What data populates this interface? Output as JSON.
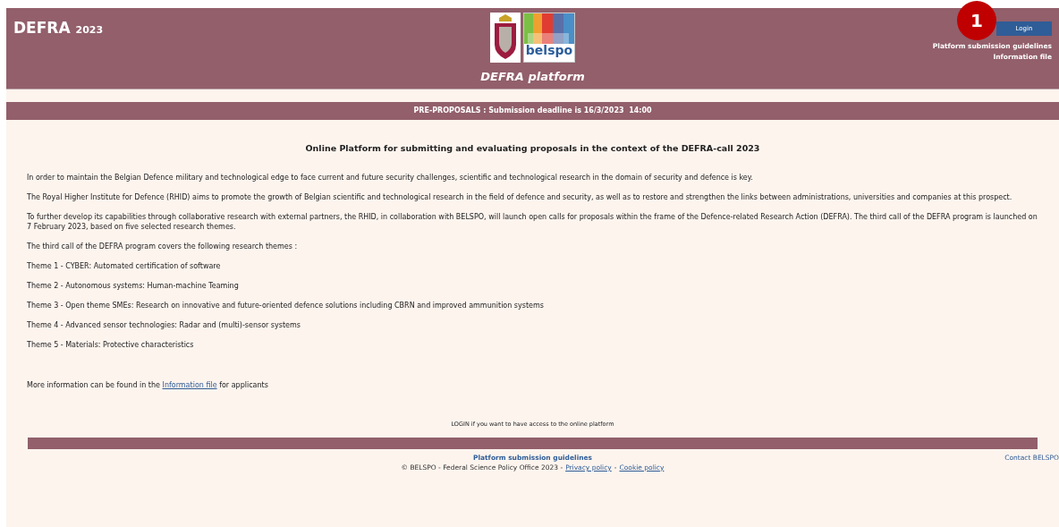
{
  "header": {
    "brand": "DEFRA",
    "year": "2023",
    "logo_text": "belspo",
    "platform_title": "DEFRA platform",
    "login_button": "Login",
    "callout_number": "1",
    "links": [
      "Platform submission guidelines",
      "Information file"
    ]
  },
  "deadline_bar": "PRE-PROPOSALS : Submission deadline is 16/3/2023  14:00",
  "content": {
    "heading": "Online Platform for submitting and evaluating proposals in the context of the DEFRA-call 2023",
    "paragraphs": [
      "In order to maintain the Belgian Defence military and technological edge to face current and future security challenges, scientific and technological research in the domain of security and defence is key.",
      "The Royal Higher Institute for Defence (RHID) aims to promote the growth of Belgian scientific and technological research in the field of defence and security, as well as to restore and strengthen the links between administrations, universities and companies at this prospect.",
      "To further develop its capabilities through collaborative research with external partners, the RHID, in collaboration with BELSPO, will launch open calls for proposals within the frame of the Defence-related Research Action (DEFRA). The third call of the DEFRA program is launched on 7 February 2023, based on five selected research themes.",
      "The third call of the DEFRA program covers the following research themes :"
    ],
    "themes": [
      "Theme 1 - CYBER: Automated certification of software",
      "Theme 2 - Autonomous systems: Human-machine Teaming",
      "Theme 3 - Open theme SMEs: Research on innovative and future-oriented defence solutions including CBRN and improved ammunition systems",
      "Theme 4 - Advanced sensor technologies: Radar and (multi)-sensor systems",
      "Theme 5 - Materials: Protective characteristics"
    ],
    "more_info": {
      "before": "More information can be found in the",
      "link": "Information file",
      "after": "for applicants"
    },
    "login_note": "LOGIN if you want to have access to the online platform"
  },
  "footer": {
    "guidelines": "Platform submission guidelines",
    "copyright": "© BELSPO - Federal Science Policy Office 2023 -",
    "privacy": "Privacy policy",
    "separator": "-",
    "cookie": "Cookie policy",
    "contact": "Contact BELSPO"
  }
}
